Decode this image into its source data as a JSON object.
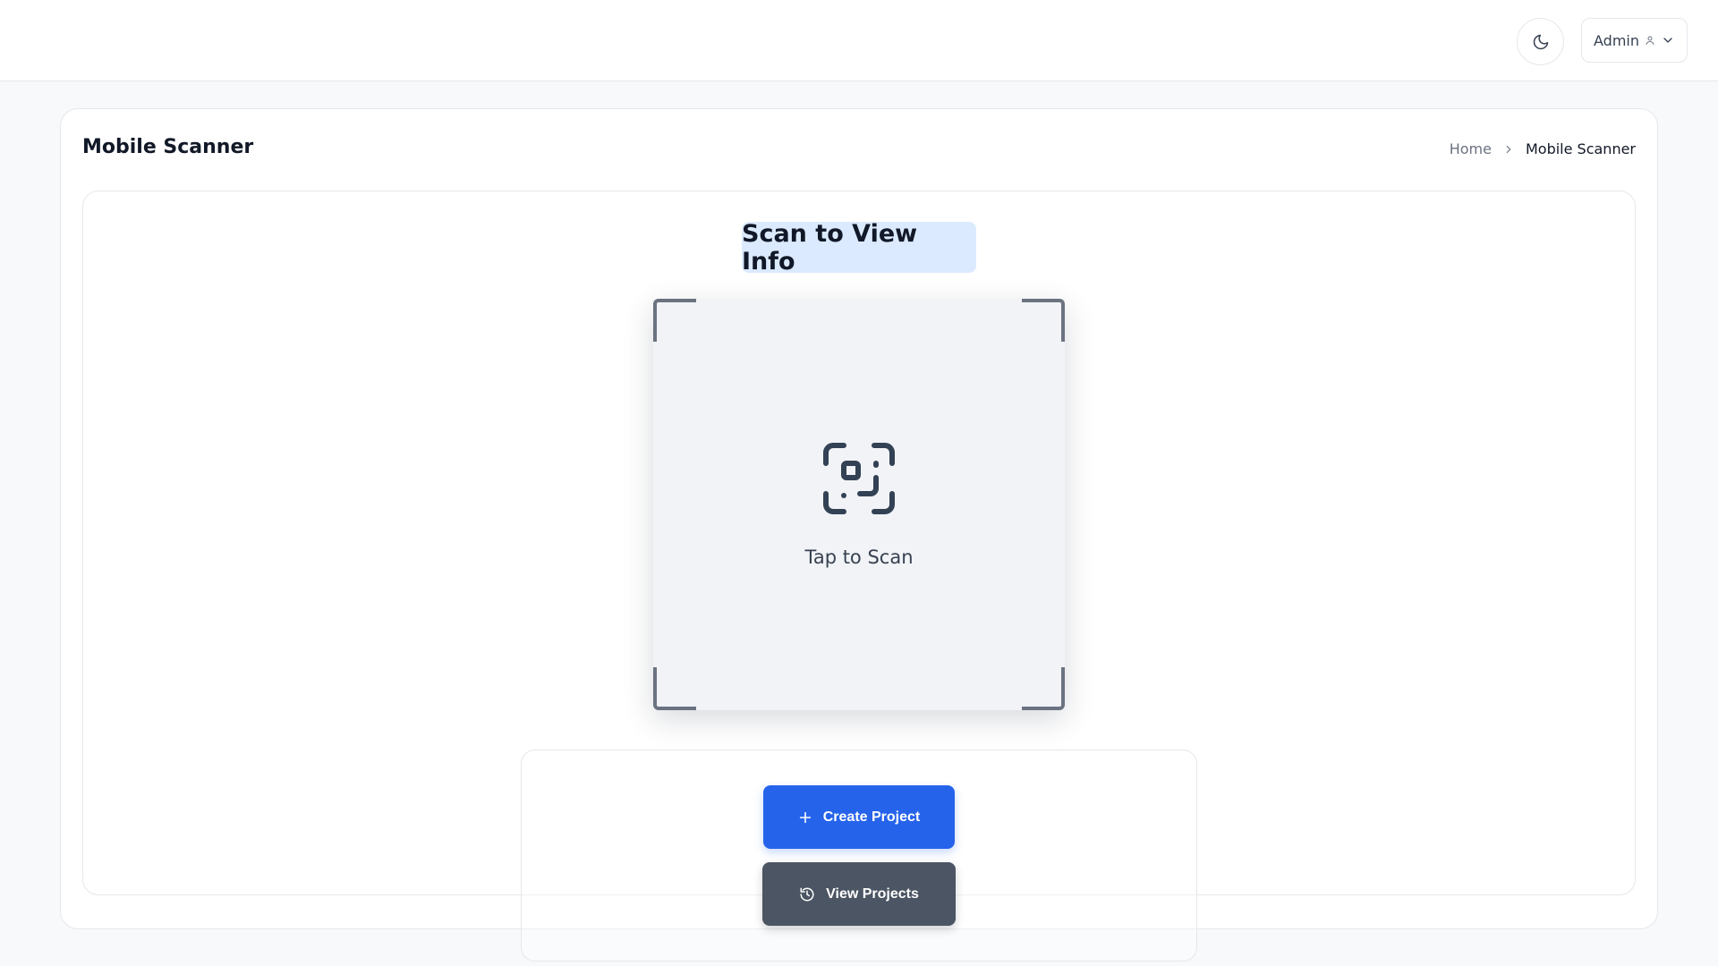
{
  "header": {
    "user_label": "Admin",
    "icons": [
      "moon-icon",
      "user-icon",
      "chevron-down-icon"
    ]
  },
  "page": {
    "title": "Mobile Scanner",
    "breadcrumb": {
      "home": "Home",
      "current": "Mobile Scanner"
    }
  },
  "scanner": {
    "heading": "Scan to View Info",
    "tap_label": "Tap to Scan",
    "icon": "scan-icon"
  },
  "actions": {
    "create_label": "Create Project",
    "create_icon": "plus-icon",
    "view_label": "View Projects",
    "view_icon": "history-icon"
  },
  "colors": {
    "primary": "#2563eb",
    "secondary": "#4b5563",
    "heading_highlight": "#dbeafe",
    "scan_bg": "#f1f3f6"
  }
}
